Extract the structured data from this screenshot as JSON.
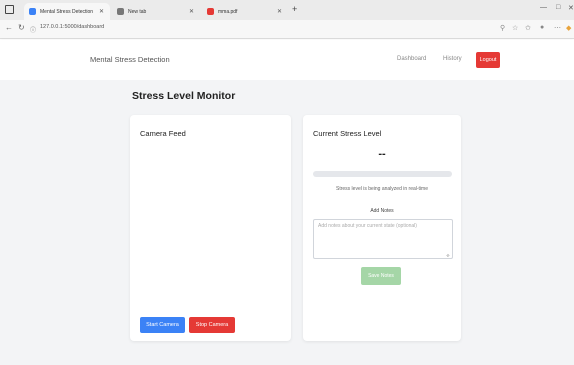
{
  "browser": {
    "tabs": [
      {
        "title": "Mental Stress Detection",
        "active": true,
        "favicon_color": "#3b82f6"
      },
      {
        "title": "New tab",
        "active": false,
        "favicon_color": "#777777"
      },
      {
        "title": "mma.pdf",
        "active": false,
        "favicon_color": "#e53935"
      }
    ],
    "url": "127.0.0.1:5000/dashboard",
    "icons": {
      "window": "window-icon",
      "back": "back-arrow-icon",
      "reload": "reload-icon",
      "info": "site-info-icon",
      "new_tab": "plus-icon",
      "minimize": "minimize-icon",
      "close": "close-icon"
    }
  },
  "app": {
    "brand": "Mental Stress Detection",
    "nav": {
      "dashboard": "Dashboard",
      "history": "History",
      "logout": "Logout"
    }
  },
  "page": {
    "title": "Stress Level Monitor",
    "camera": {
      "title": "Camera Feed",
      "start_label": "Start Camera",
      "stop_label": "Stop Camera"
    },
    "stress": {
      "title": "Current Stress Level",
      "value": "--",
      "level_fraction": 0,
      "status": "Stress level is being analyzed in real-time",
      "notes_label": "Add Notes",
      "notes_placeholder": "Add notes about your current state (optional)",
      "notes_value": "",
      "save_label": "Save Notes"
    }
  },
  "colors": {
    "primary": "#3b82f6",
    "danger": "#e53935",
    "success_disabled": "#a5d6a7",
    "page_bg": "#f3f4f6"
  }
}
